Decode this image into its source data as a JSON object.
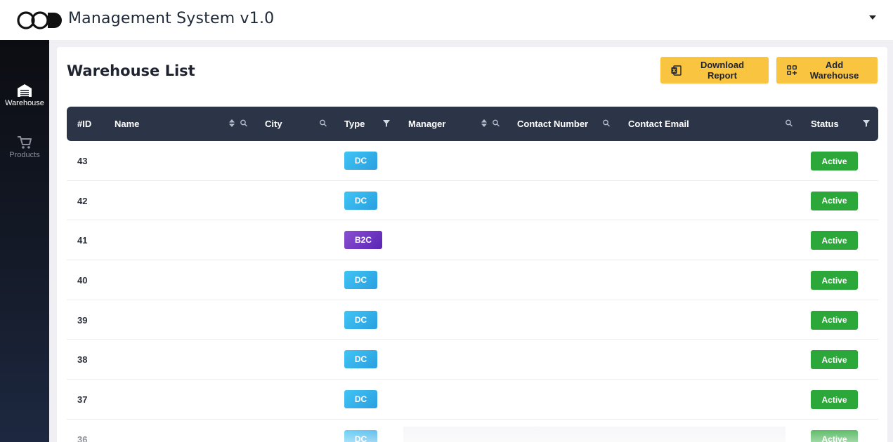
{
  "app": {
    "title": "Management System v1.0"
  },
  "sidebar": {
    "items": [
      {
        "label": "Warehouse",
        "icon": "warehouse-icon",
        "active": true
      },
      {
        "label": "Products",
        "icon": "cart-icon",
        "active": false
      }
    ]
  },
  "page": {
    "title": "Warehouse List",
    "download_label": "Download Report",
    "add_label": "Add Warehouse"
  },
  "table": {
    "columns": [
      "#ID",
      "Name",
      "City",
      "Type",
      "Manager",
      "Contact Number",
      "Contact Email",
      "Status"
    ],
    "rows": [
      {
        "id": "43",
        "type": "DC",
        "status": "Active"
      },
      {
        "id": "42",
        "type": "DC",
        "status": "Active"
      },
      {
        "id": "41",
        "type": "B2C",
        "status": "Active"
      },
      {
        "id": "40",
        "type": "DC",
        "status": "Active"
      },
      {
        "id": "39",
        "type": "DC",
        "status": "Active"
      },
      {
        "id": "38",
        "type": "DC",
        "status": "Active"
      },
      {
        "id": "37",
        "type": "DC",
        "status": "Active"
      },
      {
        "id": "36",
        "type": "DC",
        "status": "Active"
      }
    ]
  },
  "colors": {
    "accent": "#f9c440",
    "header_bg": "#2c3547",
    "status_active": "#2ca83a",
    "type_dc": "#2a9fe0",
    "type_b2c": "#5a25b5"
  }
}
